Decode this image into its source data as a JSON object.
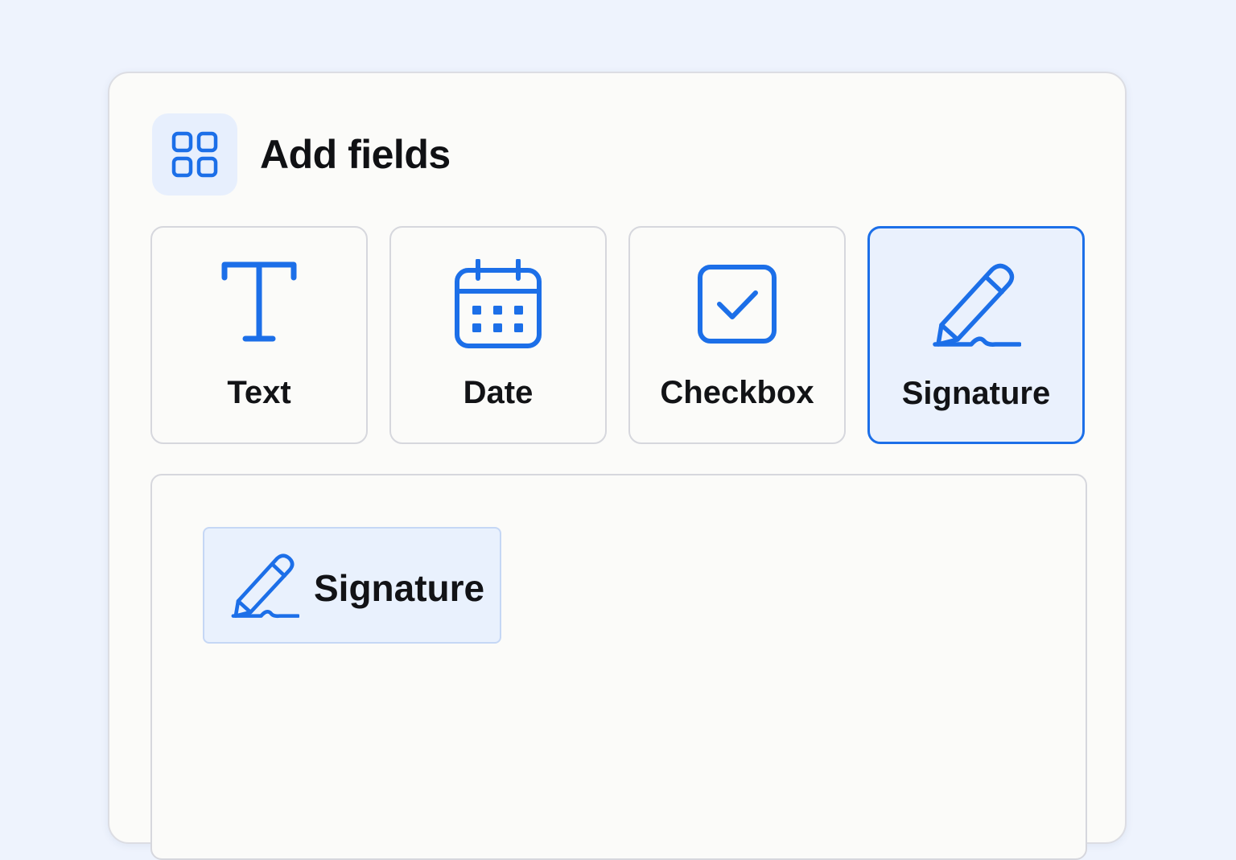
{
  "panel": {
    "title": "Add fields",
    "title_icon": "grid-icon"
  },
  "fields": [
    {
      "label": "Text",
      "icon": "text-icon",
      "selected": false
    },
    {
      "label": "Date",
      "icon": "calendar-icon",
      "selected": false
    },
    {
      "label": "Checkbox",
      "icon": "checkbox-icon",
      "selected": false
    },
    {
      "label": "Signature",
      "icon": "signature-pen-icon",
      "selected": true
    }
  ],
  "canvas": {
    "placed_field": {
      "label": "Signature",
      "icon": "signature-pen-icon"
    }
  },
  "colors": {
    "accent": "#1c6fe8",
    "selected_background": "#eaf1fd",
    "page_background": "#eef3fd"
  }
}
